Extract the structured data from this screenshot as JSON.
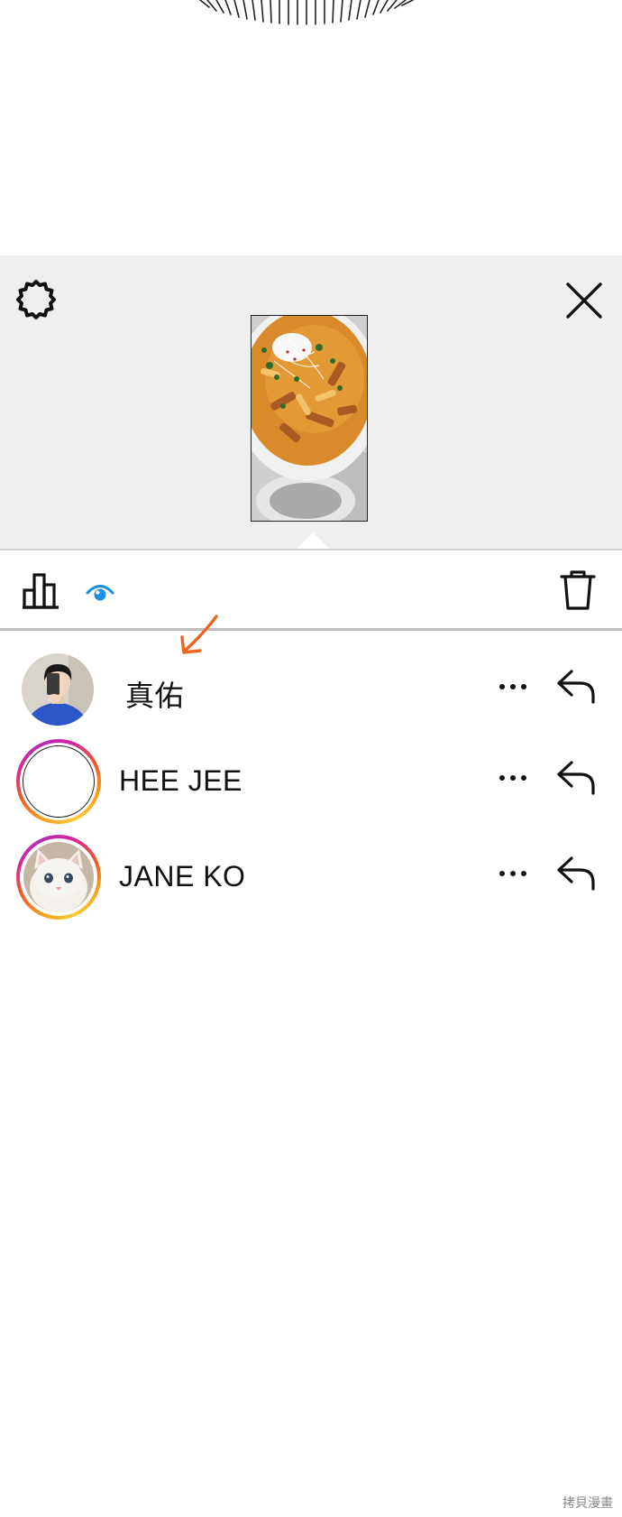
{
  "story": {
    "thumbnail_alt": "story-food-photo"
  },
  "toolbar": {
    "insights_icon": "bar-chart-icon",
    "views_icon": "eye-icon",
    "delete_icon": "trash-icon"
  },
  "viewers": [
    {
      "name": "真佑",
      "avatar": "photo-person-selfie",
      "story_ring": false
    },
    {
      "name": "HEE JEE",
      "avatar": "blank",
      "story_ring": true
    },
    {
      "name": "JANE KO",
      "avatar": "photo-white-cat",
      "story_ring": true
    }
  ],
  "icons": {
    "settings": "gear-icon",
    "close": "close-icon",
    "more": "more-dots-icon",
    "reply": "reply-arrow-icon"
  },
  "colors": {
    "panel_bg": "#efefef",
    "accent_blue": "#1a8fe3",
    "annotation_orange": "#f0651e"
  },
  "watermark": "拷貝漫畫"
}
